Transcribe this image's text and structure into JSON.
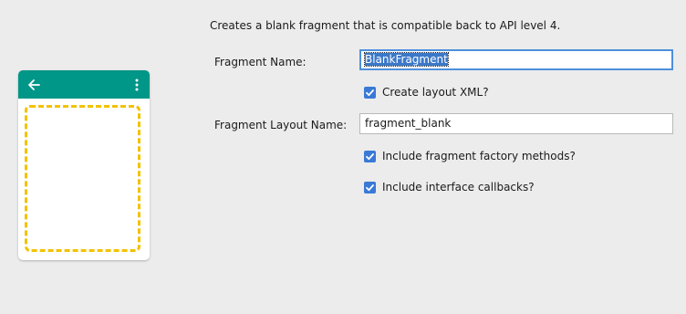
{
  "description": "Creates a blank fragment that is compatible back to API level 4.",
  "preview": {
    "appbar_color": "#009688",
    "fragment_outline_color": "#f2c200",
    "back_icon": "arrow-left-icon",
    "menu_icon": "more-vertical-icon"
  },
  "fields": {
    "fragment_name": {
      "label": "Fragment Name:",
      "value": "BlankFragment"
    },
    "layout_name": {
      "label": "Fragment Layout Name:",
      "value": "fragment_blank"
    }
  },
  "checkboxes": {
    "create_layout": {
      "label": "Create layout XML?",
      "checked": true
    },
    "factory_methods": {
      "label": "Include fragment factory methods?",
      "checked": true
    },
    "interface_callbacks": {
      "label": "Include interface callbacks?",
      "checked": true
    }
  },
  "colors": {
    "checkbox": "#3a79d6",
    "focus": "#4d8fdc",
    "selection": "#3c78c8"
  }
}
